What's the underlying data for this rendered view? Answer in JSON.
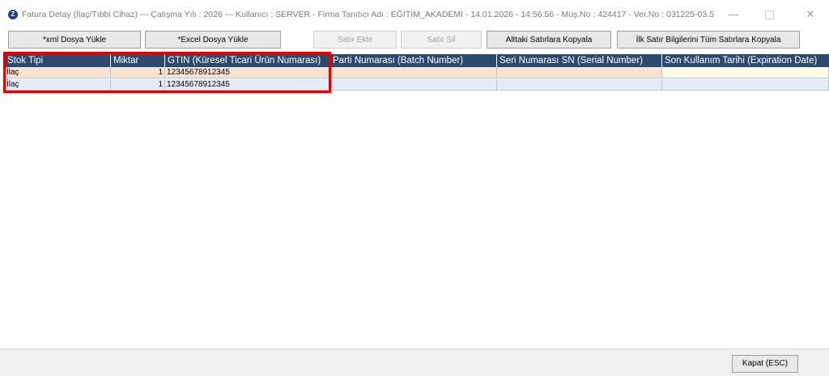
{
  "window": {
    "icon_glyph": "Z",
    "title": "Fatura Detay (İlaç/Tıbbi Cihaz)  ---  Çalışma Yılı : 2026  ---  Kullanıcı : SERVER - Firma Tanıtıcı Adı : EĞİTİM_AKADEMİ - 14.01.2026 - 14:56:56 - Müş.No : 424417 - Ver.No : 031225-03.5",
    "min_glyph": "—",
    "close_glyph": "✕"
  },
  "toolbar": {
    "xml_upload": "*xml Dosya Yükle",
    "excel_upload": "*Excel Dosya Yükle",
    "add_row": "Satır Ekle",
    "delete_row": "Satır Sil",
    "copy_below": "Alttaki Satırlara Kopyala",
    "copy_first_all": "İlk Satır Bilgilerini Tüm Satırlara Kopyala"
  },
  "grid": {
    "columns": [
      "Stok Tipi",
      "Miktar",
      "GTIN (Küresel Ticari Ürün Numarası)",
      "Parti Numarası (Batch Number)",
      "Seri Numarası SN (Serial Number)",
      "Son Kullanım Tarihi (Expiration Date)"
    ],
    "rows": [
      [
        "İlaç",
        "1",
        "12345678912345",
        "",
        "",
        ""
      ],
      [
        "İlaç",
        "1",
        "12345678912345",
        "",
        "",
        ""
      ]
    ]
  },
  "footer": {
    "close_label": "Kapat (ESC)"
  },
  "colors": {
    "header_bg": "#2c4a6e",
    "row_selected": "#fbe3cf",
    "row_alt": "#e5ecf7",
    "highlight_box": "#e10000"
  }
}
